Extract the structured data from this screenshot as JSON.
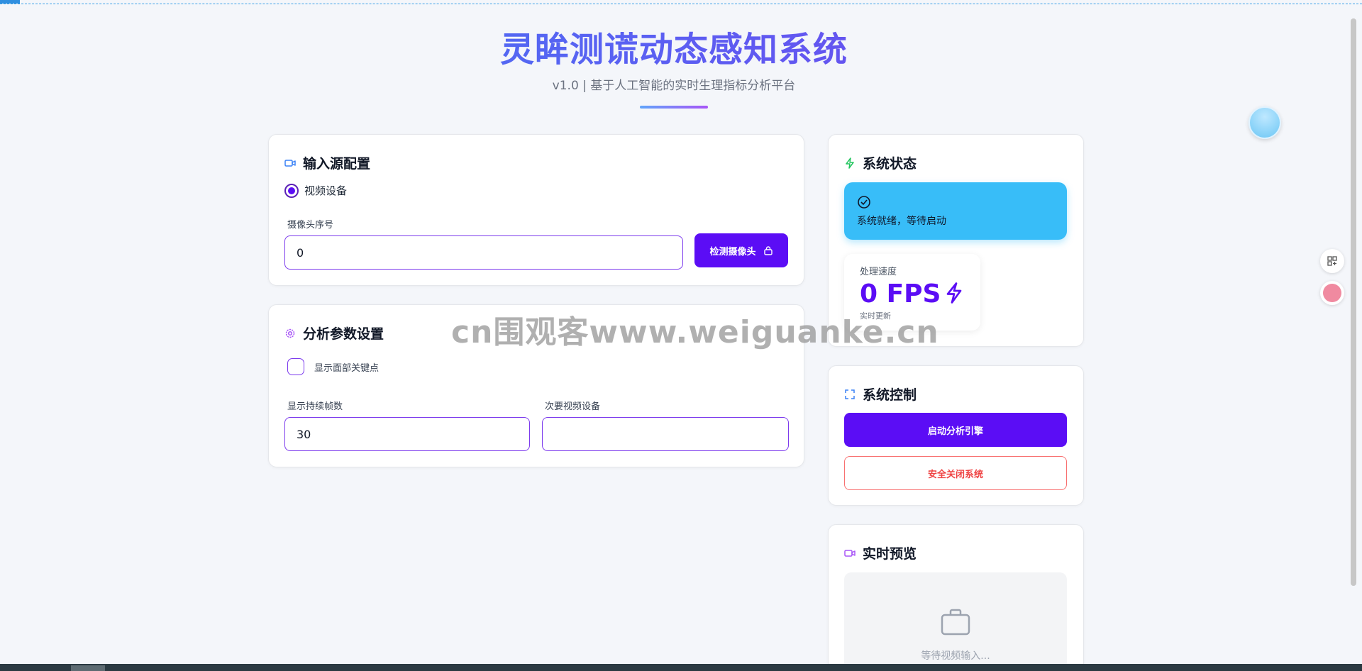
{
  "header": {
    "title": "灵眸测谎动态感知系统",
    "subtitle": "v1.0 | 基于人工智能的实时生理指标分析平台"
  },
  "input_source": {
    "title": "输入源配置",
    "icon": "video-camera-icon",
    "radio_label": "视频设备",
    "camera_index_label": "摄像头序号",
    "camera_index_value": "0",
    "detect_button": "检测摄像头"
  },
  "analysis": {
    "title": "分析参数设置",
    "icon": "gear-icon",
    "show_landmarks_label": "显示面部关键点",
    "duration_label": "显示持续帧数",
    "duration_value": "30",
    "secondary_label": "次要视频设备",
    "secondary_value": ""
  },
  "system_status": {
    "title": "系统状态",
    "icon": "bolt-icon",
    "status_text": "系统就绪，等待启动",
    "speed_label": "处理速度",
    "fps_value": "0 FPS",
    "speed_note": "实时更新"
  },
  "system_control": {
    "title": "系统控制",
    "icon": "expand-icon",
    "start_button": "启动分析引擎",
    "shutdown_button": "安全关闭系统"
  },
  "preview": {
    "title": "实时预览",
    "icon": "video-camera-icon",
    "waiting_text": "等待视频输入..."
  },
  "watermark": "cn围观客www.weiguanke.cn",
  "colors": {
    "primary": "#5b0df5",
    "status_bg": "#38bdf8",
    "danger": "#ef4444"
  }
}
